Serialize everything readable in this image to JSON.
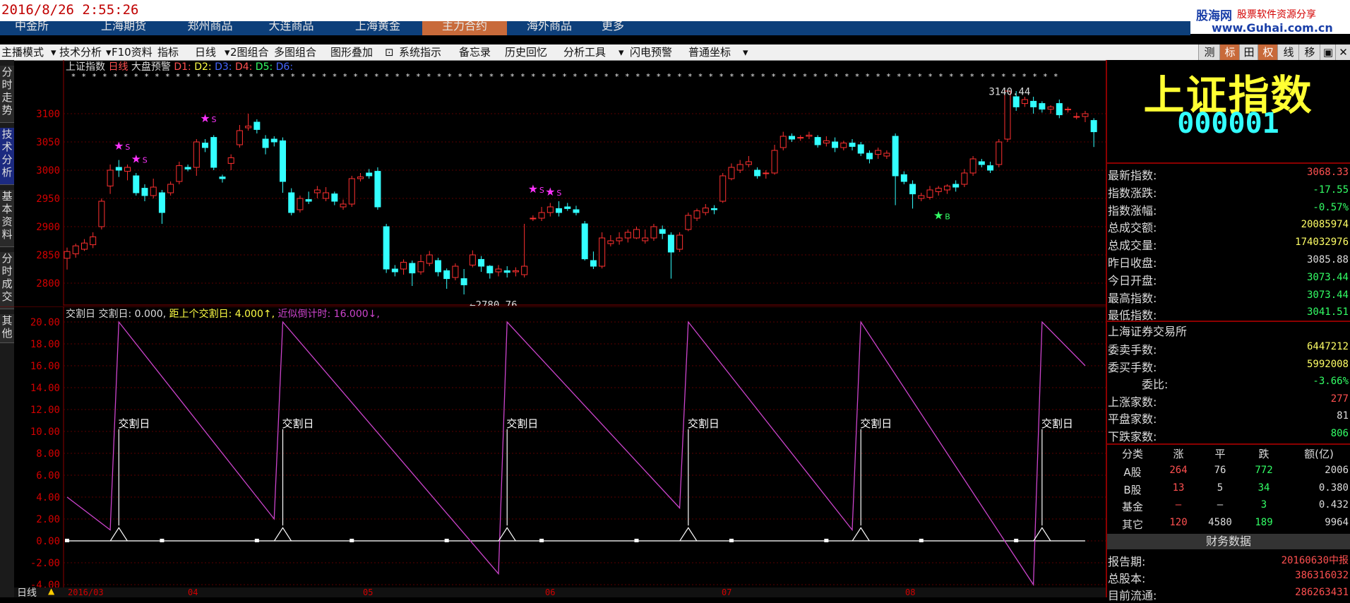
{
  "datetime": "2016/8/26 2:55:26",
  "brand": {
    "logo": "股海网",
    "slogan": "股票软件资源分享",
    "url_pre": "www.",
    "url_name": "Guhai",
    "url_post": ".com.cn"
  },
  "market_tabs": [
    "中金所",
    "上海期货",
    "郑州商品",
    "大连商品",
    "上海黄金",
    "主力合约",
    "海外商品",
    "更多"
  ],
  "toolbar": [
    "主播模式",
    "技术分析",
    "F10资料",
    "指标",
    "日线",
    "2图组合",
    "多图组合",
    "图形叠加",
    "系统指示",
    "备忘录",
    "历史回忆",
    "分析工具",
    "闪电预警",
    "普通坐标"
  ],
  "right_toolbar": [
    "测",
    "标",
    "田",
    "权",
    "线",
    "移"
  ],
  "side_tabs": [
    "分时走势",
    "技术分析",
    "基本资料",
    "分时成交",
    "其他"
  ],
  "chart_header": {
    "name": "上证指数",
    "period": "日线",
    "alert": "大盘预警",
    "d1": "D1:",
    "d2": "D2:",
    "d3": "D3:",
    "d4": "D4:",
    "d5": "D5:",
    "d6": "D6:"
  },
  "low_label": "←2780.76",
  "high_label": "3140.44",
  "buy_mark": "B",
  "sell_mark": "S",
  "indicator_header": {
    "name": "交割日",
    "part1": "交割日: 0.000,",
    "part2": "距上个交割日: 4.000↑,",
    "part3": "近似倒计时: 16.000↓,"
  },
  "delivery_label": "交割日",
  "bottom": {
    "period": "日线",
    "dates": [
      "2016/03",
      "04",
      "05",
      "06",
      "07",
      "08"
    ]
  },
  "quote": {
    "name": "上证指数",
    "code": "000001"
  },
  "quote_rows": [
    {
      "label": "最新指数:",
      "value": "3068.33",
      "color": "#ff5050"
    },
    {
      "label": "指数涨跌:",
      "value": "-17.55",
      "color": "#33ff66"
    },
    {
      "label": "指数涨幅:",
      "value": "-0.57%",
      "color": "#33ff66"
    },
    {
      "label": "总成交额:",
      "value": "20085974",
      "color": "#ffff66"
    },
    {
      "label": "总成交量:",
      "value": "174032976",
      "color": "#ffff66"
    },
    {
      "label": "昨日收盘:",
      "value": "3085.88",
      "color": "#dddddd"
    },
    {
      "label": "今日开盘:",
      "value": "3073.44",
      "color": "#33ff66"
    },
    {
      "label": "最高指数:",
      "value": "3073.44",
      "color": "#33ff66"
    },
    {
      "label": "最低指数:",
      "value": "3041.51",
      "color": "#33ff66"
    }
  ],
  "exchange": "上海证券交易所",
  "order_rows": [
    {
      "label": "委卖手数:",
      "value": "6447212",
      "color": "#ffff66"
    },
    {
      "label": "委买手数:",
      "value": "5992008",
      "color": "#ffff66"
    },
    {
      "label": "委比:",
      "value": "-3.66%",
      "color": "#33ff66"
    },
    {
      "label": "上涨家数:",
      "value": "277",
      "color": "#ff5050"
    },
    {
      "label": "平盘家数:",
      "value": "81",
      "color": "#dddddd"
    },
    {
      "label": "下跌家数:",
      "value": "806",
      "color": "#33ff66"
    }
  ],
  "table": {
    "headers": [
      "分类",
      "涨",
      "平",
      "跌",
      "额(亿)"
    ],
    "rows": [
      {
        "cat": "A股",
        "up": "264",
        "flat": "76",
        "down": "772",
        "amt": "2006"
      },
      {
        "cat": "B股",
        "up": "13",
        "flat": "5",
        "down": "34",
        "amt": "0.380"
      },
      {
        "cat": "基金",
        "up": "–",
        "flat": "–",
        "down": "3",
        "amt": "0.432"
      },
      {
        "cat": "其它",
        "up": "120",
        "flat": "4580",
        "down": "189",
        "amt": "9964"
      }
    ]
  },
  "finance": {
    "title": "财务数据",
    "rows": [
      {
        "label": "报告期:",
        "value": "20160630中报"
      },
      {
        "label": "总股本:",
        "value": "386316032"
      },
      {
        "label": "目前流通:",
        "value": "286263431"
      }
    ]
  },
  "colors": {
    "up": "#ff3030",
    "down": "#33ffff",
    "grid": "#5a0000",
    "purple": "#cc44cc",
    "accent": "#c86a3a"
  },
  "chart_data": [
    {
      "type": "candlestick",
      "title": "上证指数 日线",
      "ylim": [
        2760,
        3170
      ],
      "yticks": [
        2800,
        2850,
        2900,
        2950,
        3000,
        3050,
        3100
      ],
      "candles": [
        [
          2844,
          2856,
          2824,
          2863
        ],
        [
          2852,
          2866,
          2845,
          2870
        ],
        [
          2860,
          2871,
          2857,
          2878
        ],
        [
          2868,
          2882,
          2862,
          2890
        ],
        [
          2900,
          2945,
          2895,
          2950
        ],
        [
          2972,
          3000,
          2958,
          3010
        ],
        [
          3005,
          3000,
          2988,
          3018
        ],
        [
          2998,
          3005,
          2982,
          3010
        ],
        [
          2990,
          2960,
          2955,
          2995
        ],
        [
          2968,
          2955,
          2945,
          2975
        ],
        [
          2955,
          2970,
          2950,
          2985
        ],
        [
          2960,
          2925,
          2905,
          2965
        ],
        [
          2960,
          2975,
          2955,
          2980
        ],
        [
          2980,
          3008,
          2975,
          3015
        ],
        [
          3005,
          3002,
          2998,
          3010
        ],
        [
          3005,
          3050,
          2990,
          3055
        ],
        [
          3048,
          3040,
          3032,
          3055
        ],
        [
          3058,
          3005,
          3000,
          3062
        ],
        [
          2988,
          2985,
          2978,
          2992
        ],
        [
          3012,
          3022,
          3000,
          3028
        ],
        [
          3045,
          3070,
          3040,
          3080
        ],
        [
          3075,
          3078,
          3070,
          3100
        ],
        [
          3085,
          3072,
          3065,
          3090
        ],
        [
          3055,
          3040,
          3028,
          3062
        ],
        [
          3055,
          3050,
          3042,
          3060
        ],
        [
          3052,
          2980,
          2960,
          3058
        ],
        [
          2960,
          2925,
          2920,
          2968
        ],
        [
          2930,
          2950,
          2925,
          2955
        ],
        [
          2948,
          2945,
          2940,
          2962
        ],
        [
          2960,
          2965,
          2950,
          2972
        ],
        [
          2950,
          2960,
          2945,
          2970
        ],
        [
          2958,
          2945,
          2938,
          2962
        ],
        [
          2935,
          2940,
          2930,
          2948
        ],
        [
          2940,
          2985,
          2935,
          2990
        ],
        [
          2985,
          2988,
          2980,
          2995
        ],
        [
          2995,
          2990,
          2985,
          3002
        ],
        [
          2998,
          2935,
          2930,
          3005
        ],
        [
          2900,
          2825,
          2818,
          2905
        ],
        [
          2825,
          2820,
          2812,
          2832
        ],
        [
          2825,
          2837,
          2815,
          2842
        ],
        [
          2835,
          2818,
          2795,
          2840
        ],
        [
          2820,
          2838,
          2815,
          2850
        ],
        [
          2835,
          2850,
          2830,
          2857
        ],
        [
          2840,
          2820,
          2812,
          2845
        ],
        [
          2822,
          2808,
          2790,
          2826
        ],
        [
          2810,
          2830,
          2805,
          2835
        ],
        [
          2808,
          2797,
          2780,
          2825
        ],
        [
          2832,
          2850,
          2828,
          2858
        ],
        [
          2842,
          2830,
          2820,
          2848
        ],
        [
          2830,
          2818,
          2808,
          2832
        ],
        [
          2820,
          2825,
          2812,
          2832
        ],
        [
          2822,
          2819,
          2810,
          2830
        ],
        [
          2820,
          2822,
          2812,
          2828
        ],
        [
          2815,
          2830,
          2810,
          2905
        ],
        [
          2915,
          2915,
          2910,
          2920
        ],
        [
          2915,
          2925,
          2910,
          2935
        ],
        [
          2925,
          2935,
          2918,
          2942
        ],
        [
          2932,
          2925,
          2918,
          2945
        ],
        [
          2935,
          2932,
          2928,
          2942
        ],
        [
          2930,
          2925,
          2920,
          2937
        ],
        [
          2905,
          2843,
          2840,
          2910
        ],
        [
          2840,
          2830,
          2825,
          2856
        ],
        [
          2830,
          2880,
          2826,
          2890
        ],
        [
          2870,
          2875,
          2865,
          2885
        ],
        [
          2875,
          2880,
          2868,
          2890
        ],
        [
          2880,
          2890,
          2872,
          2895
        ],
        [
          2880,
          2895,
          2878,
          2900
        ],
        [
          2875,
          2880,
          2870,
          2895
        ],
        [
          2880,
          2900,
          2875,
          2905
        ],
        [
          2895,
          2888,
          2878,
          2902
        ],
        [
          2885,
          2855,
          2808,
          2890
        ],
        [
          2860,
          2885,
          2855,
          2890
        ],
        [
          2895,
          2920,
          2892,
          2925
        ],
        [
          2915,
          2928,
          2910,
          2932
        ],
        [
          2925,
          2933,
          2920,
          2940
        ],
        [
          2932,
          2930,
          2922,
          2938
        ],
        [
          2945,
          2990,
          2942,
          2995
        ],
        [
          2985,
          3005,
          2982,
          3012
        ],
        [
          3000,
          3010,
          2995,
          3018
        ],
        [
          3010,
          3015,
          3005,
          3025
        ],
        [
          3000,
          2990,
          2985,
          3005
        ],
        [
          2995,
          2995,
          2985,
          3000
        ],
        [
          2995,
          3035,
          2992,
          3045
        ],
        [
          3040,
          3060,
          3035,
          3068
        ],
        [
          3060,
          3055,
          3050,
          3065
        ],
        [
          3058,
          3058,
          3052,
          3062
        ],
        [
          3060,
          3062,
          3055,
          3068
        ],
        [
          3058,
          3045,
          3040,
          3062
        ],
        [
          3048,
          3052,
          3042,
          3060
        ],
        [
          3050,
          3040,
          3032,
          3058
        ],
        [
          3040,
          3048,
          3035,
          3052
        ],
        [
          3048,
          3042,
          3035,
          3055
        ],
        [
          3045,
          3030,
          3025,
          3050
        ],
        [
          3030,
          3020,
          3012,
          3035
        ],
        [
          3028,
          3035,
          3020,
          3040
        ],
        [
          3025,
          3030,
          3020,
          3035
        ],
        [
          3060,
          2990,
          2938,
          3065
        ],
        [
          2992,
          2980,
          2975,
          2998
        ],
        [
          2975,
          2958,
          2932,
          2982
        ],
        [
          2950,
          2955,
          2945,
          2960
        ],
        [
          2952,
          2965,
          2948,
          2972
        ],
        [
          2962,
          2968,
          2955,
          2972
        ],
        [
          2965,
          2972,
          2958,
          2975
        ],
        [
          2975,
          2970,
          2962,
          2982
        ],
        [
          2975,
          2995,
          2970,
          3002
        ],
        [
          2995,
          3020,
          2990,
          3025
        ],
        [
          3015,
          3010,
          3005,
          3020
        ],
        [
          3008,
          3000,
          2995,
          3015
        ],
        [
          3010,
          3050,
          3005,
          3055
        ],
        [
          3055,
          3140,
          3050,
          3140
        ],
        [
          3130,
          3112,
          3105,
          3140
        ],
        [
          3118,
          3125,
          3112,
          3130
        ],
        [
          3122,
          3112,
          3100,
          3130
        ],
        [
          3118,
          3108,
          3102,
          3122
        ],
        [
          3108,
          3112,
          3100,
          3115
        ],
        [
          3118,
          3098,
          3092,
          3125
        ],
        [
          3108,
          3108,
          3102,
          3112
        ],
        [
          3095,
          3095,
          3090,
          3102
        ],
        [
          3095,
          3100,
          3085,
          3105
        ],
        [
          3088,
          3068,
          3041,
          3092
        ]
      ],
      "signals": [
        {
          "type": "S",
          "index": 6,
          "price": 3036
        },
        {
          "type": "S",
          "index": 8,
          "price": 3013
        },
        {
          "type": "S",
          "index": 16,
          "price": 3085
        },
        {
          "type": "S",
          "index": 54,
          "price": 2960
        },
        {
          "type": "S",
          "index": 56,
          "price": 2955
        },
        {
          "type": "B",
          "index": 101,
          "price": 2913
        }
      ],
      "low": {
        "value": 2780.76,
        "index": 46
      },
      "high": {
        "value": 3140.44,
        "index": 106
      }
    },
    {
      "type": "line",
      "title": "交割日",
      "ylim": [
        -4,
        20
      ],
      "yticks": [
        -4.0,
        -2.0,
        0.0,
        2.0,
        4.0,
        6.0,
        8.0,
        10.0,
        12.0,
        14.0,
        16.0,
        18.0,
        20.0
      ],
      "series": [
        {
          "values": [
            4,
            1,
            20,
            2,
            20,
            -3,
            20,
            3,
            20,
            1,
            20,
            -4,
            20,
            16
          ],
          "x": [
            0,
            5,
            6,
            24,
            25,
            50,
            51,
            71,
            72,
            91,
            92,
            112,
            113,
            118
          ]
        }
      ],
      "delivery_days": [
        6,
        25,
        51,
        72,
        92,
        113
      ]
    }
  ]
}
